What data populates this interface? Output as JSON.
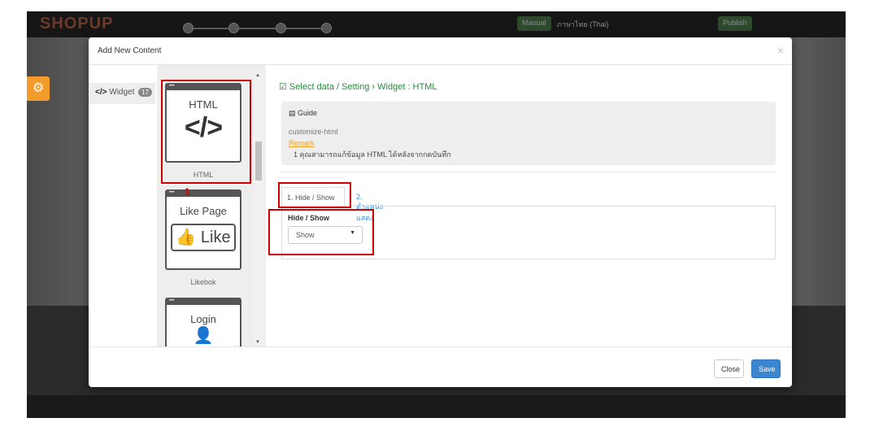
{
  "app": {
    "brand": "SHOPUP",
    "top_buttons": [
      "Manual",
      "ภาษาไทย (Thai)",
      "Publish"
    ],
    "gear_icon": "gear-icon"
  },
  "modal": {
    "title": "Add New Content",
    "close_symbol": "×",
    "nav": {
      "label": "Widget",
      "prefix": "</>",
      "count": "17"
    },
    "widgets": [
      {
        "title": "HTML",
        "icon": "</>",
        "label": "HTML"
      },
      {
        "title": "Like Page",
        "icon": "👍 Like",
        "label": "Likebok"
      },
      {
        "title": "Login",
        "icon": "👤"
      }
    ],
    "breadcrumb": "Select data / Setting › Widget : HTML",
    "guide": {
      "title": "Guide",
      "subtitle": "customize-html",
      "remark": "Remark",
      "note": "1 คุณสามารถแก้ข้อมูล HTML ได้หลังจากกดบันทึก"
    },
    "tabs": [
      "1. Hide / Show",
      "2. ตำแหน่งแสดง"
    ],
    "field": {
      "label": "Hide / Show",
      "value": "Show"
    },
    "annotation": "1",
    "buttons": {
      "close": "Close",
      "save": "Save"
    }
  }
}
